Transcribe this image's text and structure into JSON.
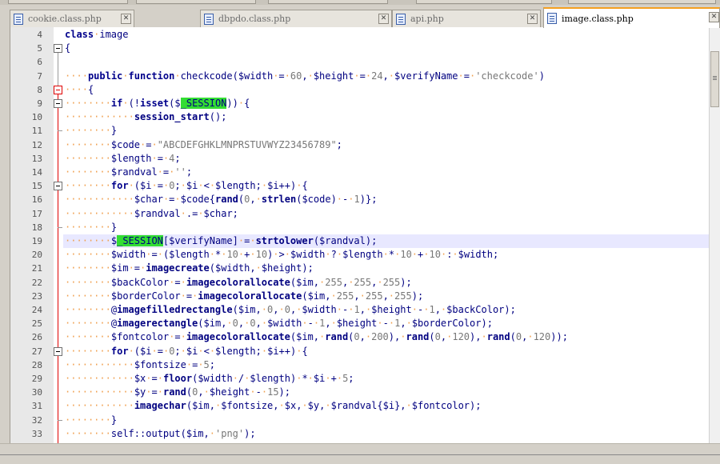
{
  "tabs": [
    {
      "label": "cookie.class.php",
      "active": false
    },
    {
      "label": "dbpdo.class.php",
      "active": false
    },
    {
      "label": "api.php",
      "active": false
    },
    {
      "label": "image.class.php",
      "active": true
    }
  ],
  "close_glyph": "✕",
  "editor": {
    "highlight_line": 19,
    "lines": [
      {
        "n": "4",
        "src": "class image"
      },
      {
        "n": "5",
        "src": "{"
      },
      {
        "n": "6",
        "src": ""
      },
      {
        "n": "7",
        "src": "    public function checkcode($width = 60, $height = 24, $verifyName = 'checkcode')"
      },
      {
        "n": "8",
        "src": "    {"
      },
      {
        "n": "9",
        "src": "        if (!isset($_SESSION)) {"
      },
      {
        "n": "10",
        "src": "            session_start();"
      },
      {
        "n": "11",
        "src": "        }"
      },
      {
        "n": "12",
        "src": "        $code = \"ABCDEFGHKLMNPRSTUVWYZ23456789\";"
      },
      {
        "n": "13",
        "src": "        $length = 4;"
      },
      {
        "n": "14",
        "src": "        $randval = '';"
      },
      {
        "n": "15",
        "src": "        for ($i = 0; $i < $length; $i++) {"
      },
      {
        "n": "16",
        "src": "            $char = $code{rand(0, strlen($code) - 1)};"
      },
      {
        "n": "17",
        "src": "            $randval .= $char;"
      },
      {
        "n": "18",
        "src": "        }"
      },
      {
        "n": "19",
        "src": "        $_SESSION[$verifyName] = strtolower($randval);"
      },
      {
        "n": "20",
        "src": "        $width = ($length * 10 + 10) > $width ? $length * 10 + 10 : $width;"
      },
      {
        "n": "21",
        "src": "        $im = imagecreate($width, $height);"
      },
      {
        "n": "22",
        "src": "        $backColor = imagecolorallocate($im, 255, 255, 255);"
      },
      {
        "n": "23",
        "src": "        $borderColor = imagecolorallocate($im, 255, 255, 255);"
      },
      {
        "n": "24",
        "src": "        @imagefilledrectangle($im, 0, 0, $width - 1, $height - 1, $backColor);"
      },
      {
        "n": "25",
        "src": "        @imagerectangle($im, 0, 0, $width - 1, $height - 1, $borderColor);"
      },
      {
        "n": "26",
        "src": "        $fontcolor = imagecolorallocate($im, rand(0, 200), rand(0, 120), rand(0, 120));"
      },
      {
        "n": "27",
        "src": "        for ($i = 0; $i < $length; $i++) {"
      },
      {
        "n": "28",
        "src": "            $fontsize = 5;"
      },
      {
        "n": "29",
        "src": "            $x = floor($width / $length) * $i + 5;"
      },
      {
        "n": "30",
        "src": "            $y = rand(0, $height - 15);"
      },
      {
        "n": "31",
        "src": "            imagechar($im, $fontsize, $x, $y, $randval{$i}, $fontcolor);"
      },
      {
        "n": "32",
        "src": "        }"
      },
      {
        "n": "33",
        "src": "        self::output($im, 'png');"
      }
    ]
  }
}
